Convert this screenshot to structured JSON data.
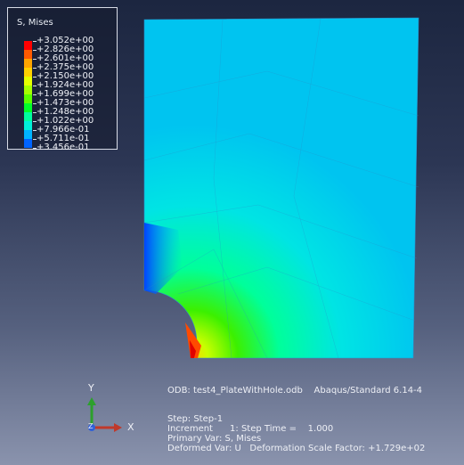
{
  "legend": {
    "title": "S, Mises",
    "values": [
      "+3.052e+00",
      "+2.826e+00",
      "+2.601e+00",
      "+2.375e+00",
      "+2.150e+00",
      "+1.924e+00",
      "+1.699e+00",
      "+1.473e+00",
      "+1.248e+00",
      "+1.022e+00",
      "+7.966e-01",
      "+5.711e-01",
      "+3.456e-01"
    ],
    "colors": [
      "#ff0000",
      "#ff5a00",
      "#ffa500",
      "#ffd100",
      "#e6ff00",
      "#a6ff00",
      "#5aff00",
      "#00ff2a",
      "#00ff9e",
      "#00f0d8",
      "#00b4ff",
      "#0064ff",
      "#0000ff"
    ]
  },
  "info": {
    "odb": "ODB: test4_PlateWithHole.odb    Abaqus/Standard 6.14-4",
    "step": "Step: Step-1",
    "increment": "Increment      1: Step Time =    1.000",
    "primary": "Primary Var: S, Mises",
    "deformed": "Deformed Var: U   Deformation Scale Factor: +1.729e+02"
  },
  "triad": {
    "y": "Y",
    "x": "X",
    "z": "Z",
    "y_color": "#2ca02c",
    "x_color": "#c0392b",
    "z_color": "#3060d8"
  }
}
